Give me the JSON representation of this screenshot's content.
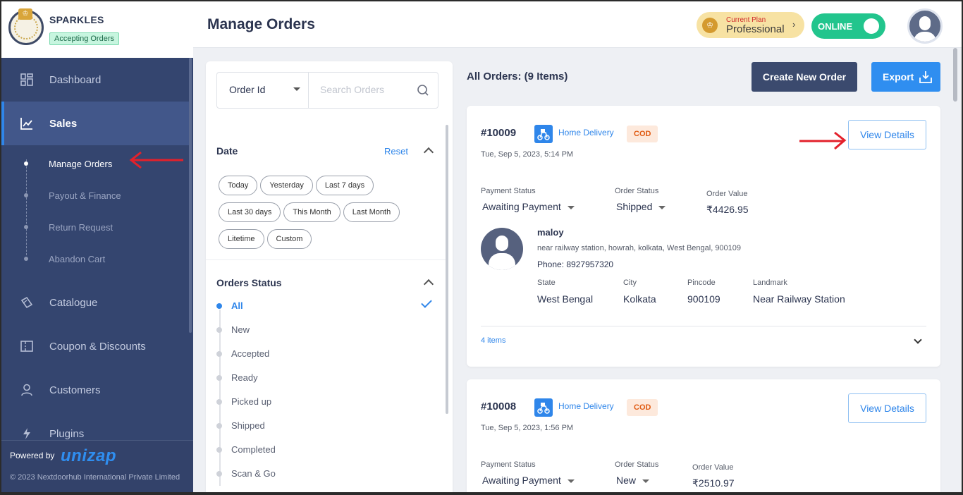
{
  "brand": {
    "name": "SPARKLES",
    "status": "Accepting Orders"
  },
  "sidebar": {
    "items": [
      {
        "label": "Dashboard"
      },
      {
        "label": "Sales"
      },
      {
        "label": "Catalogue"
      },
      {
        "label": "Coupon & Discounts"
      },
      {
        "label": "Customers"
      },
      {
        "label": "Plugins"
      }
    ],
    "sales_sub": [
      {
        "label": "Manage Orders"
      },
      {
        "label": "Payout & Finance"
      },
      {
        "label": "Return Request"
      },
      {
        "label": "Abandon Cart"
      }
    ],
    "powered_by": "Powered by",
    "logo_text": "unizap",
    "copyright": "© 2023 Nextdoorhub International Private Limited"
  },
  "header": {
    "title": "Manage Orders",
    "plan_caption": "Current Plan",
    "plan_name": "Professional",
    "online_label": "ONLINE"
  },
  "filters": {
    "search_field": "Order Id",
    "search_placeholder": "Search Orders",
    "date_title": "Date",
    "reset_label": "Reset",
    "date_chips": [
      "Today",
      "Yesterday",
      "Last 7 days",
      "Last 30 days",
      "This Month",
      "Last Month",
      "Litetime",
      "Custom"
    ],
    "status_title": "Orders Status",
    "statuses": [
      "All",
      "New",
      "Accepted",
      "Ready",
      "Picked up",
      "Shipped",
      "Completed",
      "Scan & Go"
    ]
  },
  "orders": {
    "title": "All Orders: (9 Items)",
    "create_label": "Create New Order",
    "export_label": "Export",
    "labels": {
      "payment_status": "Payment Status",
      "order_status": "Order Status",
      "order_value": "Order Value",
      "state": "State",
      "city": "City",
      "pincode": "Pincode",
      "landmark": "Landmark",
      "view_details": "View Details"
    },
    "list": [
      {
        "id": "#10009",
        "delivery": "Home Delivery",
        "payment_method": "COD",
        "date": "Tue, Sep 5, 2023, 5:14 PM",
        "payment_status": "Awaiting Payment",
        "order_status": "Shipped",
        "order_value": "₹4426.95",
        "customer_name": "maloy",
        "address": "near railway station, howrah, kolkata, West Bengal, 900109",
        "phone": "Phone: 8927957320",
        "state": "West Bengal",
        "city": "Kolkata",
        "pincode": "900109",
        "landmark": "Near Railway Station",
        "items": "4 items"
      },
      {
        "id": "#10008",
        "delivery": "Home Delivery",
        "payment_method": "COD",
        "date": "Tue, Sep 5, 2023, 1:56 PM",
        "payment_status": "Awaiting Payment",
        "order_status": "New",
        "order_value": "₹2510.97"
      }
    ]
  },
  "colors": {
    "accent": "#2f86ea",
    "sidebar": "#34456f",
    "annotation_arrow": "#e3212b"
  }
}
